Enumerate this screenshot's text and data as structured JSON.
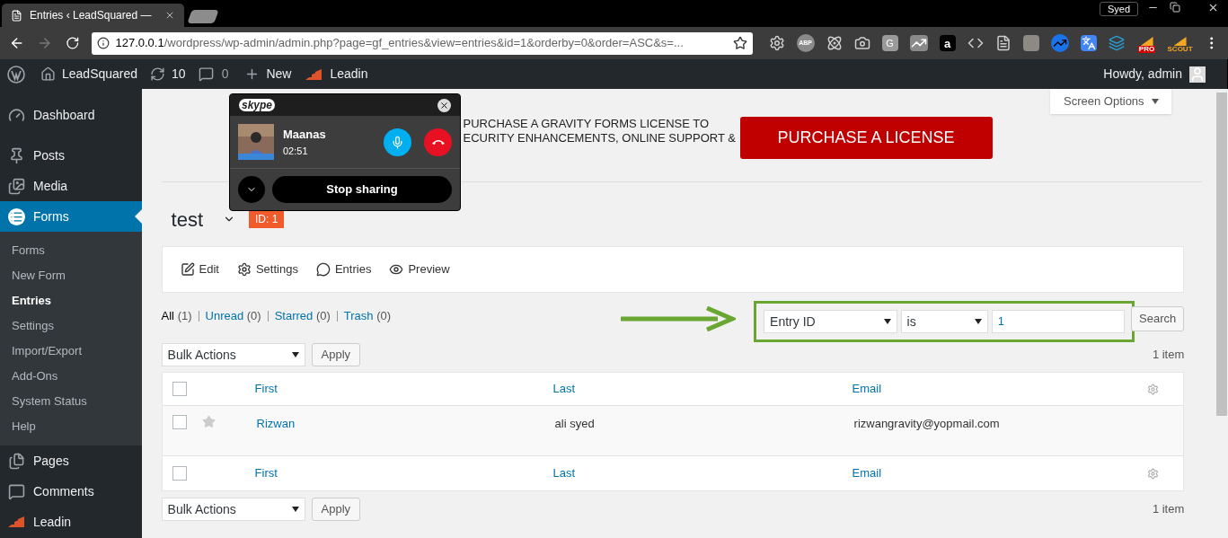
{
  "browser": {
    "tab_title": "Entries ‹ LeadSquared —",
    "profile": "Syed",
    "url_host": "127.0.0.1",
    "url_path": "/wordpress/wp-admin/admin.php?page=gf_entries&view=entries&id=1&orderby=0&order=ASC&s=...",
    "extensions": [
      {
        "kind": "gear"
      },
      {
        "kind": "badge",
        "label": "ABP"
      },
      {
        "kind": "atom"
      },
      {
        "kind": "camera"
      },
      {
        "kind": "tile",
        "label": "G"
      },
      {
        "kind": "chart"
      },
      {
        "kind": "amazon",
        "label": "a"
      },
      {
        "kind": "code"
      },
      {
        "kind": "doc"
      },
      {
        "kind": "camel"
      },
      {
        "kind": "trend"
      },
      {
        "kind": "translate"
      },
      {
        "kind": "stack"
      },
      {
        "kind": "rocket",
        "label": "PRO"
      },
      {
        "kind": "rocket",
        "label": "SCOUT"
      }
    ]
  },
  "admin_bar": {
    "site": "LeadSquared",
    "updates": "10",
    "comments": "0",
    "new": "New",
    "plugin": "Leadin",
    "greeting": "Howdy, admin"
  },
  "sidebar": {
    "items": [
      {
        "label": "Dashboard",
        "kind": "dashboard",
        "selected": false
      },
      {
        "label": "Posts",
        "kind": "pin",
        "selected": false
      },
      {
        "label": "Media",
        "kind": "media",
        "selected": false
      },
      {
        "label": "Forms",
        "kind": "forms",
        "selected": true,
        "children": [
          {
            "label": "Forms",
            "selected": false
          },
          {
            "label": "New Form",
            "selected": false
          },
          {
            "label": "Entries",
            "selected": true
          },
          {
            "label": "Settings",
            "selected": false
          },
          {
            "label": "Import/Export",
            "selected": false
          },
          {
            "label": "Add-Ons",
            "selected": false
          },
          {
            "label": "System Status",
            "selected": false
          },
          {
            "label": "Help",
            "selected": false
          }
        ]
      },
      {
        "label": "Pages",
        "kind": "pages",
        "selected": false
      },
      {
        "label": "Comments",
        "kind": "comments",
        "selected": false
      },
      {
        "label": "Leadin",
        "kind": "leadin",
        "selected": false
      }
    ]
  },
  "screen_options": "Screen Options",
  "banner": {
    "lines": [
      "PURCHASE A GRAVITY FORMS LICENSE TO",
      "ECURITY ENHANCEMENTS, ONLINE SUPPORT &"
    ],
    "button": "PURCHASE A LICENSE"
  },
  "skype": {
    "logo": "skype",
    "caller": "Maanas",
    "duration": "02:51",
    "stop_button": "Stop sharing"
  },
  "form": {
    "title": "test",
    "id_badge": "ID: 1"
  },
  "toolbar": [
    {
      "kind": "edit",
      "label": "Edit"
    },
    {
      "kind": "settings",
      "label": "Settings"
    },
    {
      "kind": "entries",
      "label": "Entries"
    },
    {
      "kind": "preview",
      "label": "Preview"
    }
  ],
  "filters": [
    {
      "label": "All",
      "count": "(1)",
      "selected": true
    },
    {
      "label": "Unread",
      "count": "(0)",
      "selected": false
    },
    {
      "label": "Starred",
      "count": "(0)",
      "selected": false
    },
    {
      "label": "Trash",
      "count": "(0)",
      "selected": false
    }
  ],
  "search": {
    "field": "Entry ID",
    "operator": "is",
    "value": "1",
    "button": "Search"
  },
  "bulk_top": {
    "select": "Bulk Actions",
    "button": "Apply",
    "count": "1 item"
  },
  "table": {
    "header_checked": false,
    "footer_checked": false,
    "columns": [
      "First",
      "Last",
      "Email"
    ],
    "rows": [
      {
        "first": "Rizwan",
        "last": "ali syed",
        "email": "rizwangravity@yopmail.com",
        "checked": false,
        "starred": false
      }
    ],
    "footer_columns": [
      "First",
      "Last",
      "Email"
    ]
  },
  "bulk_bottom": {
    "select": "Bulk Actions",
    "button": "Apply",
    "count": "1 item"
  }
}
